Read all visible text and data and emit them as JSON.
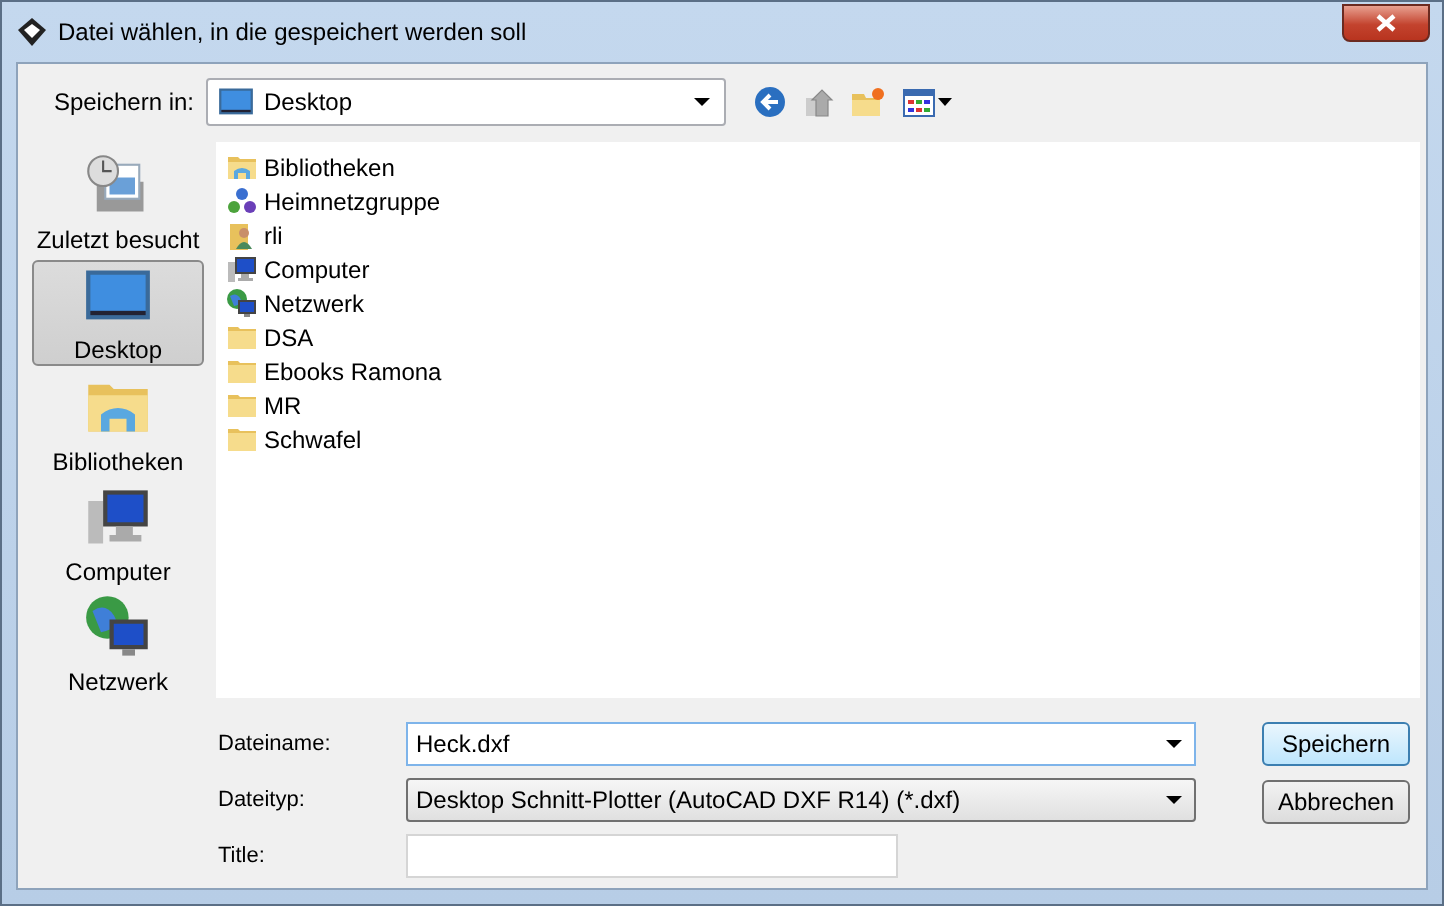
{
  "window": {
    "title": "Datei wählen, in die gespeichert werden soll"
  },
  "save_in": {
    "label": "Speichern in:",
    "value": "Desktop"
  },
  "places": [
    {
      "label": "Zuletzt besucht",
      "kind": "recent",
      "selected": false
    },
    {
      "label": "Desktop",
      "kind": "desktop",
      "selected": true
    },
    {
      "label": "Bibliotheken",
      "kind": "library",
      "selected": false
    },
    {
      "label": "Computer",
      "kind": "computer",
      "selected": false
    },
    {
      "label": "Netzwerk",
      "kind": "network",
      "selected": false
    }
  ],
  "files": [
    {
      "name": "Bibliotheken",
      "kind": "library"
    },
    {
      "name": "Heimnetzgruppe",
      "kind": "homegroup"
    },
    {
      "name": "rli",
      "kind": "user"
    },
    {
      "name": "Computer",
      "kind": "computer"
    },
    {
      "name": "Netzwerk",
      "kind": "network"
    },
    {
      "name": "DSA",
      "kind": "folder"
    },
    {
      "name": "Ebooks Ramona",
      "kind": "folder"
    },
    {
      "name": "MR",
      "kind": "folder"
    },
    {
      "name": "Schwafel",
      "kind": "folder"
    }
  ],
  "filename": {
    "label": "Dateiname:",
    "value": "Heck.dxf"
  },
  "filetype": {
    "label": "Dateityp:",
    "value": "Desktop Schnitt-Plotter (AutoCAD DXF R14) (*.dxf)"
  },
  "title_field": {
    "label": "Title:"
  },
  "buttons": [
    {
      "label": "Speichern",
      "default": true
    },
    {
      "label": "Abbrechen",
      "default": false
    }
  ]
}
